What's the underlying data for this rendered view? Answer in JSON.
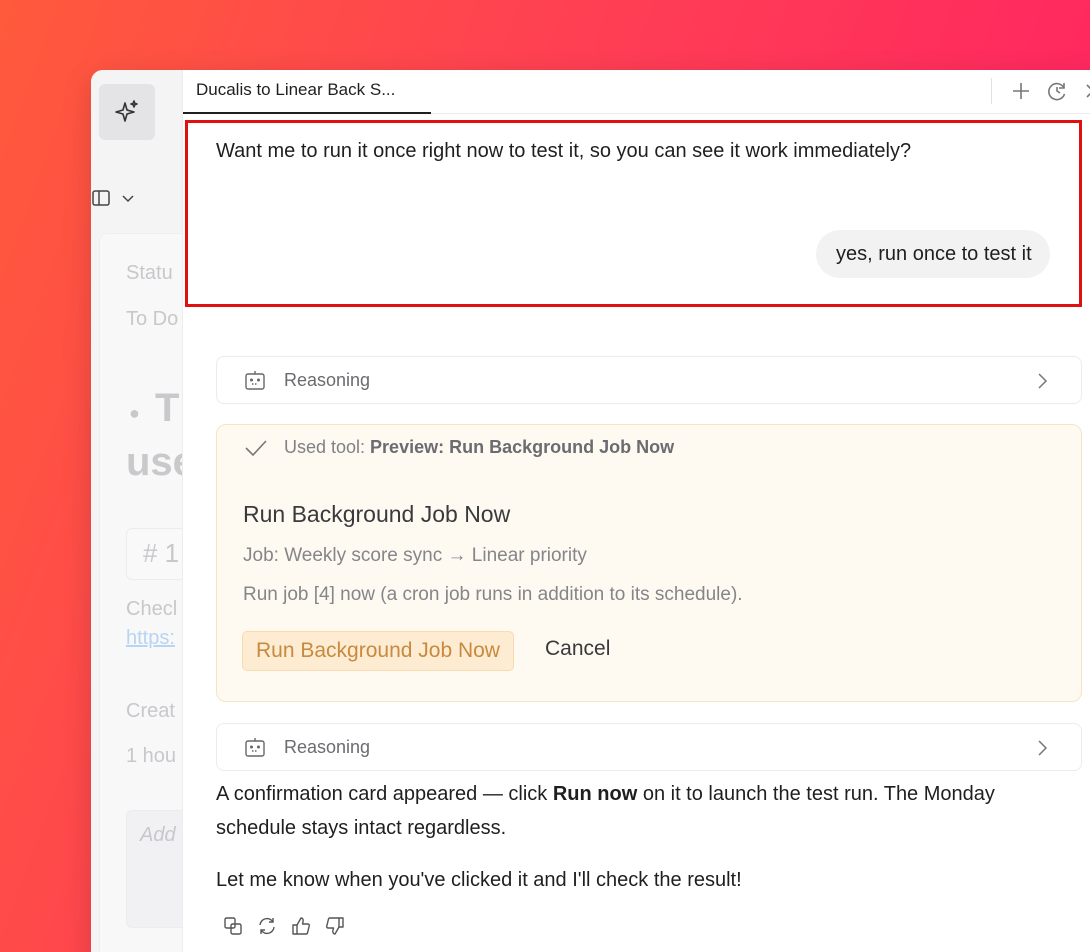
{
  "sidebar": {
    "ai_icon": "sparkle-icon",
    "panel_icon": "panel-layout-icon",
    "background_fragments": {
      "status_label": "Statu",
      "status_value": "To Do",
      "title_line1": "T",
      "title_line2": "use",
      "tag": "# 1",
      "check_text": "Checl",
      "link_text": "https:",
      "created_label": "Creat",
      "created_value": "1 hou",
      "add_placeholder": "Add"
    }
  },
  "tab": {
    "title": "Ducalis to Linear Back S...",
    "actions": [
      "plus-icon",
      "history-icon",
      "close-icon"
    ]
  },
  "conversation": {
    "ai_question": "Want me to run it once right now to test it, so you can see it work immediately?",
    "user_reply": "yes, run once to test it",
    "reasoning_label_1": "Reasoning",
    "reasoning_label_2": "Reasoning",
    "tool": {
      "prefix": "Used tool: ",
      "name": "Preview: Run Background Job Now",
      "card_title": "Run Background Job Now",
      "job_line": "Job: Weekly score sync → Linear priority",
      "desc_line": "Run job [4] now (a cron job runs in addition to its schedule).",
      "run_button": "Run Background Job Now",
      "cancel_button": "Cancel"
    },
    "final_part1": "A confirmation card appeared — click ",
    "final_bold": "Run now",
    "final_part2": " on it to launch the test run. The Monday schedule stays intact regardless.",
    "final_line2": "Let me know when you've clicked it and I'll check the result!",
    "feedback_icons": [
      "copy-icon",
      "regenerate-icon",
      "thumbs-up-icon",
      "thumbs-down-icon"
    ]
  },
  "colors": {
    "highlight": "#e01010",
    "tool_bg": "#fefaf2",
    "run_button_bg": "#fdecd2",
    "run_button_text": "#c78a3f"
  }
}
